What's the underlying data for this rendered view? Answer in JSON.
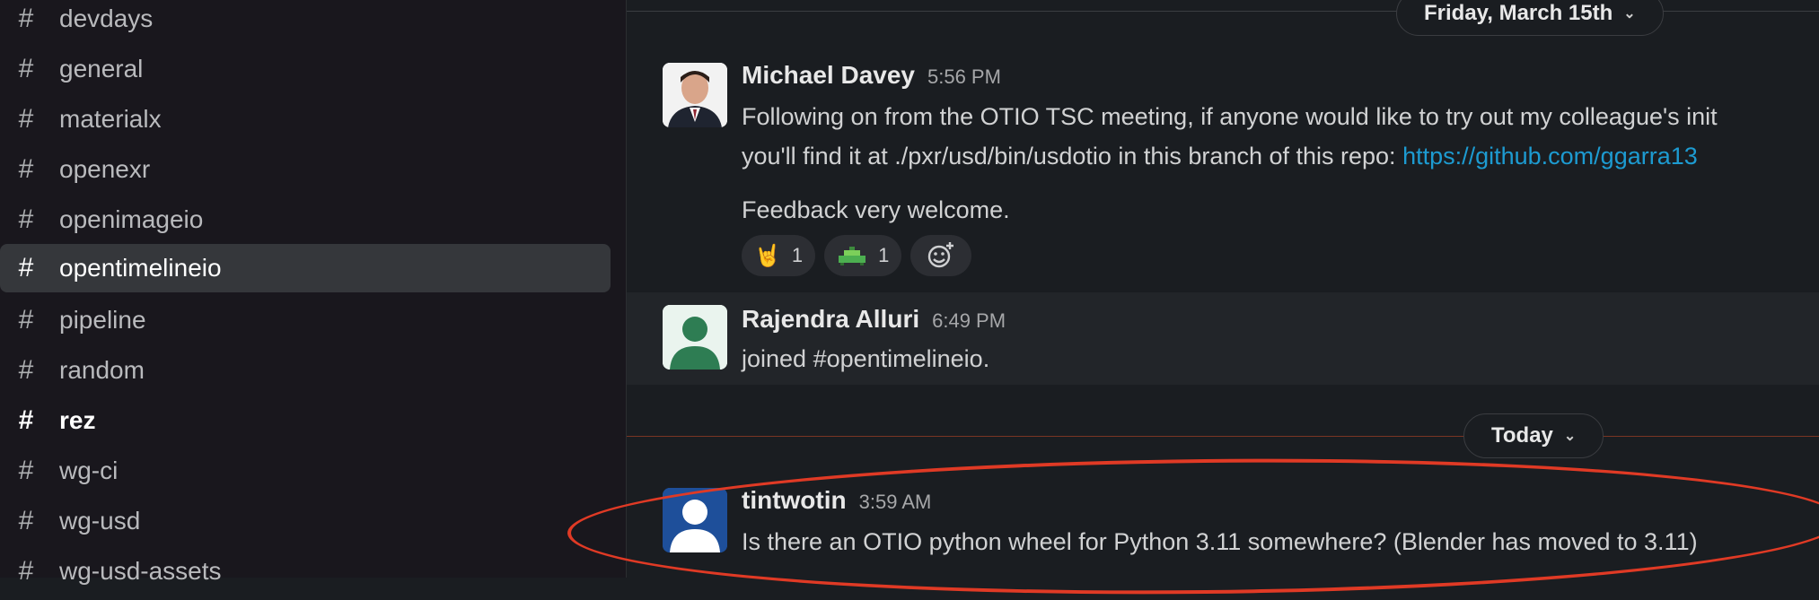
{
  "sidebar": {
    "channels": [
      {
        "label": "devdays"
      },
      {
        "label": "general"
      },
      {
        "label": "materialx"
      },
      {
        "label": "openexr"
      },
      {
        "label": "openimageio"
      },
      {
        "label": "opentimelineio",
        "active": true
      },
      {
        "label": "pipeline"
      },
      {
        "label": "random"
      },
      {
        "label": "rez",
        "unread": true
      },
      {
        "label": "wg-ci"
      },
      {
        "label": "wg-usd"
      },
      {
        "label": "wg-usd-assets"
      }
    ],
    "hash_glyph": "#"
  },
  "dividers": {
    "friday": {
      "label": "Friday, March 15th"
    },
    "today": {
      "label": "Today"
    }
  },
  "messages": [
    {
      "author": "Michael Davey",
      "time": "5:56 PM",
      "line1": "Following on from the OTIO TSC meeting, if anyone would like to try out my colleague's init",
      "line2_prefix": "you'll find it at ./pxr/usd/bin/usdotio in this branch of this repo: ",
      "line2_link": "https://github.com/ggarra13",
      "line3": "Feedback very welcome.",
      "reactions": [
        {
          "emoji": "🤘",
          "count": "1"
        },
        {
          "emoji": "custom-green-emoji",
          "count": "1"
        }
      ]
    },
    {
      "author": "Rajendra Alluri",
      "time": "6:49 PM",
      "text": "joined #opentimelineio."
    },
    {
      "author": "tintwotin",
      "time": "3:59 AM",
      "text": "Is there an OTIO python wheel for Python 3.11 somewhere? (Blender has moved to 3.11)"
    }
  ],
  "colors": {
    "accent_link": "#1d9bd1",
    "annotation": "#e03a25",
    "active_channel": "#35373b"
  }
}
